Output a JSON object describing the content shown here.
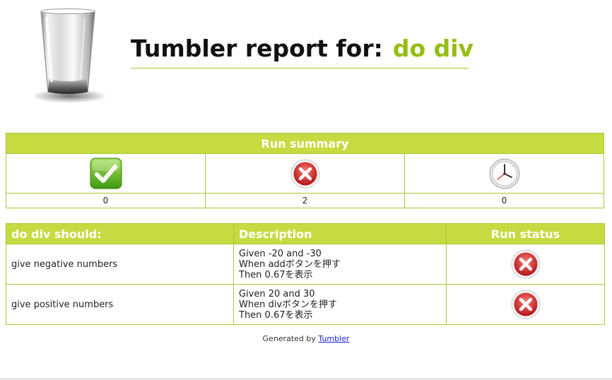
{
  "header": {
    "title_prefix": "Tumbler report for:",
    "project_name": "do div",
    "logo_icon": "glass-tumbler-icon"
  },
  "summary": {
    "title": "Run summary",
    "columns": [
      {
        "icon": "check-icon",
        "count": "0"
      },
      {
        "icon": "error-icon",
        "count": "2"
      },
      {
        "icon": "clock-icon",
        "count": "0"
      }
    ]
  },
  "details": {
    "headers": {
      "feature": "do div should:",
      "description": "Description",
      "status": "Run status"
    },
    "rows": [
      {
        "name": "give negative numbers",
        "description": [
          "Given -20 and -30",
          "When addボタンを押す",
          "Then 0.67を表示"
        ],
        "status": "error-icon"
      },
      {
        "name": "give positive numbers",
        "description": [
          "Given 20 and 30",
          "When divボタンを押す",
          "Then 0.67を表示"
        ],
        "status": "error-icon"
      }
    ]
  },
  "footer": {
    "prefix": "Generated by",
    "link_text": "Tumbler"
  },
  "colors": {
    "accent": "#c6db42",
    "project_green": "#96bd12",
    "border": "#a8c836",
    "error_red": "#d42a2a",
    "success_green": "#5fb51d"
  }
}
